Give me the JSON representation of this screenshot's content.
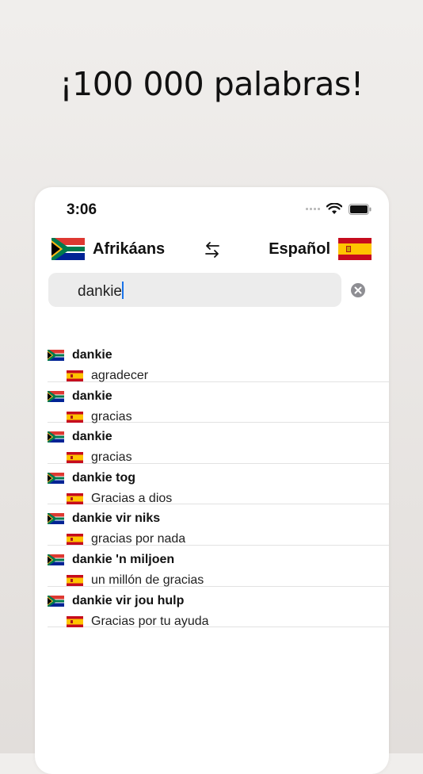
{
  "headline": "¡100 000 palabras!",
  "status": {
    "time": "3:06"
  },
  "language_bar": {
    "source": "Afrikáans",
    "target": "Español"
  },
  "search": {
    "value": "dankie"
  },
  "results": [
    {
      "term": "dankie",
      "translation": "agradecer"
    },
    {
      "term": "dankie",
      "translation": "gracias"
    },
    {
      "term": "dankie",
      "translation": "gracias"
    },
    {
      "term": "dankie tog",
      "translation": "Gracias a dios"
    },
    {
      "term": "dankie vir niks",
      "translation": "gracias por nada"
    },
    {
      "term": "dankie 'n miljoen",
      "translation": "un millón de gracias"
    },
    {
      "term": "dankie vir jou hulp",
      "translation": "Gracias por tu ayuda"
    }
  ]
}
